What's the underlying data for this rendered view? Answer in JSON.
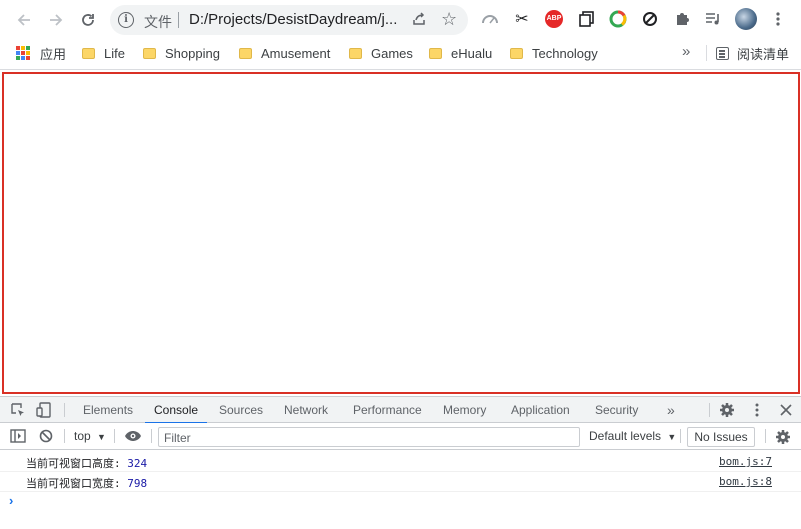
{
  "browser": {
    "address_bar": {
      "security_label": "文件",
      "url": "D:/Projects/DesistDaydream/j..."
    },
    "bookmarks": [
      {
        "label": "应用"
      },
      {
        "label": "Life"
      },
      {
        "label": "Shopping"
      },
      {
        "label": "Amusement"
      },
      {
        "label": "Games"
      },
      {
        "label": "eHualu"
      },
      {
        "label": "Technology"
      }
    ],
    "bookmarks_overflow": "»",
    "reading_list": "阅读清单",
    "extensions": [
      "gauge-icon",
      "scissors-icon",
      "abp-icon",
      "copy-icon",
      "chrome-circle-icon",
      "block-icon",
      "puzzle-icon",
      "media-icon"
    ],
    "abp_label": "ABP"
  },
  "devtools": {
    "tabs": [
      "Elements",
      "Console",
      "Sources",
      "Network",
      "Performance",
      "Memory",
      "Application",
      "Security"
    ],
    "active_tab": "Console",
    "tabs_overflow": "»",
    "console": {
      "context": "top",
      "filter_placeholder": "Filter",
      "levels": "Default levels",
      "issues": "No Issues",
      "messages": [
        {
          "label": "当前可视窗口高度:",
          "value": "324",
          "source": "bom.js:7"
        },
        {
          "label": "当前可视窗口宽度:",
          "value": "798",
          "source": "bom.js:8"
        }
      ],
      "prompt": "›"
    }
  },
  "colors": {
    "viewport_border": "#d93025",
    "accent": "#1a73e8",
    "folder": "#fcd667"
  }
}
